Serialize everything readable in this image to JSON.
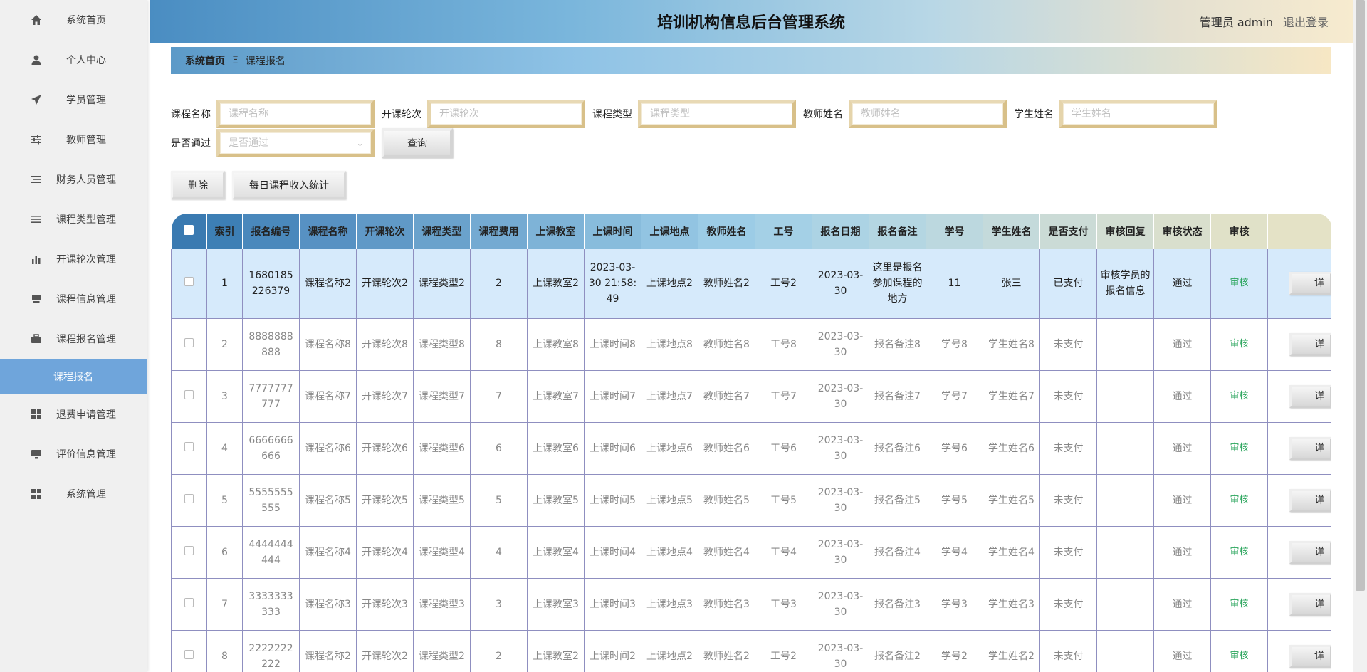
{
  "sidebar": {
    "items": [
      {
        "label": "系统首页",
        "icon": "home-icon"
      },
      {
        "label": "个人中心",
        "icon": "user-icon"
      },
      {
        "label": "学员管理",
        "icon": "send-icon"
      },
      {
        "label": "教师管理",
        "icon": "sliders-icon"
      },
      {
        "label": "财务人员管理",
        "icon": "list-icon"
      },
      {
        "label": "课程类型管理",
        "icon": "menu-icon"
      },
      {
        "label": "开课轮次管理",
        "icon": "bar-chart-icon"
      },
      {
        "label": "课程信息管理",
        "icon": "print-icon"
      },
      {
        "label": "课程报名管理",
        "icon": "briefcase-icon"
      },
      {
        "label": "退费申请管理",
        "icon": "grid-icon"
      },
      {
        "label": "评价信息管理",
        "icon": "monitor-icon"
      },
      {
        "label": "系统管理",
        "icon": "grid-icon"
      }
    ],
    "active_sub": "课程报名"
  },
  "header": {
    "title": "培训机构信息后台管理系统",
    "user": "管理员 admin",
    "logout": "退出登录"
  },
  "breadcrumb": {
    "home": "系统首页",
    "sep": "Ξ",
    "current": "课程报名"
  },
  "search": {
    "course_name_label": "课程名称",
    "course_name_placeholder": "课程名称",
    "round_label": "开课轮次",
    "round_placeholder": "开课轮次",
    "type_label": "课程类型",
    "type_placeholder": "课程类型",
    "teacher_label": "教师姓名",
    "teacher_placeholder": "教师姓名",
    "student_label": "学生姓名",
    "student_placeholder": "学生姓名",
    "pass_label": "是否通过",
    "pass_placeholder": "是否通过",
    "query_button": "查询"
  },
  "actions": {
    "delete": "删除",
    "stats": "每日课程收入统计"
  },
  "table": {
    "headers": [
      "索引",
      "报名编号",
      "课程名称",
      "开课轮次",
      "课程类型",
      "课程费用",
      "上课教室",
      "上课时间",
      "上课地点",
      "教师姓名",
      "工号",
      "报名日期",
      "报名备注",
      "学号",
      "学生姓名",
      "是否支付",
      "审核回复",
      "审核状态",
      "审核"
    ],
    "header_colors": [
      "#3d7fb5",
      "#4a88bc",
      "#5791c3",
      "#6099c7",
      "#6aa2cc",
      "#74aad2",
      "#7eb3d7",
      "#88bcdc",
      "#92c4e2",
      "#9ccce6",
      "#a4d0e6",
      "#acd3e4",
      "#b4d6e2",
      "#bcd8df",
      "#c4dadb",
      "#cbdbd6",
      "#d2ddd2",
      "#d9dfcd",
      "#e0e1c8"
    ],
    "rows": [
      {
        "idx": "1",
        "no": "1680185226379",
        "name": "课程名称2",
        "round": "开课轮次2",
        "type": "课程类型2",
        "fee": "2",
        "room": "上课教室2",
        "time": "2023-03-30 21:58:49",
        "place": "上课地点2",
        "teacher": "教师姓名2",
        "job": "工号2",
        "date": "2023-03-30",
        "remark": "这里是报名参加课程的地方",
        "sid": "11",
        "sname": "张三",
        "paid": "已支付",
        "reply": "审核学员的报名信息",
        "status": "通过",
        "audit": "审核",
        "detail": "详"
      },
      {
        "idx": "2",
        "no": "8888888888",
        "name": "课程名称8",
        "round": "开课轮次8",
        "type": "课程类型8",
        "fee": "8",
        "room": "上课教室8",
        "time": "上课时间8",
        "place": "上课地点8",
        "teacher": "教师姓名8",
        "job": "工号8",
        "date": "2023-03-30",
        "remark": "报名备注8",
        "sid": "学号8",
        "sname": "学生姓名8",
        "paid": "未支付",
        "reply": "",
        "status": "通过",
        "audit": "审核",
        "detail": "详"
      },
      {
        "idx": "3",
        "no": "7777777777",
        "name": "课程名称7",
        "round": "开课轮次7",
        "type": "课程类型7",
        "fee": "7",
        "room": "上课教室7",
        "time": "上课时间7",
        "place": "上课地点7",
        "teacher": "教师姓名7",
        "job": "工号7",
        "date": "2023-03-30",
        "remark": "报名备注7",
        "sid": "学号7",
        "sname": "学生姓名7",
        "paid": "未支付",
        "reply": "",
        "status": "通过",
        "audit": "审核",
        "detail": "详"
      },
      {
        "idx": "4",
        "no": "6666666666",
        "name": "课程名称6",
        "round": "开课轮次6",
        "type": "课程类型6",
        "fee": "6",
        "room": "上课教室6",
        "time": "上课时间6",
        "place": "上课地点6",
        "teacher": "教师姓名6",
        "job": "工号6",
        "date": "2023-03-30",
        "remark": "报名备注6",
        "sid": "学号6",
        "sname": "学生姓名6",
        "paid": "未支付",
        "reply": "",
        "status": "通过",
        "audit": "审核",
        "detail": "详"
      },
      {
        "idx": "5",
        "no": "5555555555",
        "name": "课程名称5",
        "round": "开课轮次5",
        "type": "课程类型5",
        "fee": "5",
        "room": "上课教室5",
        "time": "上课时间5",
        "place": "上课地点5",
        "teacher": "教师姓名5",
        "job": "工号5",
        "date": "2023-03-30",
        "remark": "报名备注5",
        "sid": "学号5",
        "sname": "学生姓名5",
        "paid": "未支付",
        "reply": "",
        "status": "通过",
        "audit": "审核",
        "detail": "详"
      },
      {
        "idx": "6",
        "no": "4444444444",
        "name": "课程名称4",
        "round": "开课轮次4",
        "type": "课程类型4",
        "fee": "4",
        "room": "上课教室4",
        "time": "上课时间4",
        "place": "上课地点4",
        "teacher": "教师姓名4",
        "job": "工号4",
        "date": "2023-03-30",
        "remark": "报名备注4",
        "sid": "学号4",
        "sname": "学生姓名4",
        "paid": "未支付",
        "reply": "",
        "status": "通过",
        "audit": "审核",
        "detail": "详"
      },
      {
        "idx": "7",
        "no": "3333333333",
        "name": "课程名称3",
        "round": "开课轮次3",
        "type": "课程类型3",
        "fee": "3",
        "room": "上课教室3",
        "time": "上课时间3",
        "place": "上课地点3",
        "teacher": "教师姓名3",
        "job": "工号3",
        "date": "2023-03-30",
        "remark": "报名备注3",
        "sid": "学号3",
        "sname": "学生姓名3",
        "paid": "未支付",
        "reply": "",
        "status": "通过",
        "audit": "审核",
        "detail": "详"
      },
      {
        "idx": "8",
        "no": "2222222222",
        "name": "课程名称2",
        "round": "开课轮次2",
        "type": "课程类型2",
        "fee": "2",
        "room": "上课教室2",
        "time": "上课时间2",
        "place": "上课地点2",
        "teacher": "教师姓名2",
        "job": "工号2",
        "date": "2023-03-30",
        "remark": "报名备注2",
        "sid": "学号2",
        "sname": "学生姓名2",
        "paid": "未支付",
        "reply": "",
        "status": "通过",
        "audit": "审核",
        "detail": "详"
      }
    ]
  }
}
